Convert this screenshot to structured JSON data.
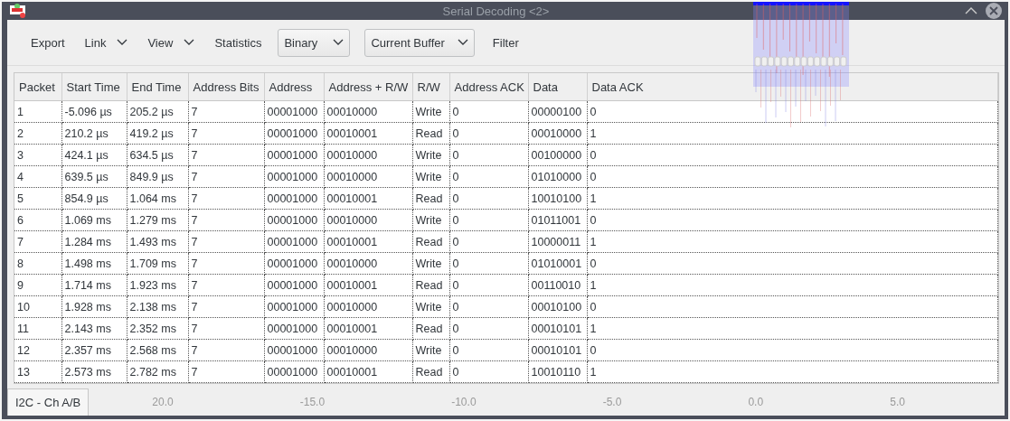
{
  "window": {
    "title": "Serial Decoding <2>"
  },
  "toolbar": [
    {
      "kind": "button",
      "label": "Export"
    },
    {
      "kind": "menu",
      "label": "Link"
    },
    {
      "kind": "menu",
      "label": "View"
    },
    {
      "kind": "button",
      "label": "Statistics"
    },
    {
      "kind": "select",
      "label": "Binary"
    },
    {
      "kind": "select",
      "label": "Current Buffer"
    },
    {
      "kind": "button",
      "label": "Filter"
    }
  ],
  "table": {
    "columns": [
      "Packet",
      "Start Time",
      "End Time",
      "Address Bits",
      "Address",
      "Address + R/W",
      "R/W",
      "Address ACK",
      "Data",
      "Data ACK"
    ],
    "rows": [
      [
        "1",
        "-5.096 µs",
        "205.2 µs",
        "7",
        "00001000",
        "00010000",
        "Write",
        "0",
        "00000100",
        "0"
      ],
      [
        "2",
        "210.2 µs",
        "419.2 µs",
        "7",
        "00001000",
        "00010001",
        "Read",
        "0",
        "00010000",
        "1"
      ],
      [
        "3",
        "424.1 µs",
        "634.5 µs",
        "7",
        "00001000",
        "00010000",
        "Write",
        "0",
        "00100000",
        "0"
      ],
      [
        "4",
        "639.5 µs",
        "849.9 µs",
        "7",
        "00001000",
        "00010000",
        "Write",
        "0",
        "01010000",
        "0"
      ],
      [
        "5",
        "854.9 µs",
        "1.064 ms",
        "7",
        "00001000",
        "00010001",
        "Read",
        "0",
        "10010100",
        "1"
      ],
      [
        "6",
        "1.069 ms",
        "1.279 ms",
        "7",
        "00001000",
        "00010000",
        "Write",
        "0",
        "01011001",
        "0"
      ],
      [
        "7",
        "1.284 ms",
        "1.493 ms",
        "7",
        "00001000",
        "00010001",
        "Read",
        "0",
        "10000011",
        "1"
      ],
      [
        "8",
        "1.498 ms",
        "1.709 ms",
        "7",
        "00001000",
        "00010000",
        "Write",
        "0",
        "01010001",
        "0"
      ],
      [
        "9",
        "1.714 ms",
        "1.923 ms",
        "7",
        "00001000",
        "00010001",
        "Read",
        "0",
        "00110010",
        "1"
      ],
      [
        "10",
        "1.928 ms",
        "2.138 ms",
        "7",
        "00001000",
        "00010000",
        "Write",
        "0",
        "00010100",
        "0"
      ],
      [
        "11",
        "2.143 ms",
        "2.352 ms",
        "7",
        "00001000",
        "00010001",
        "Read",
        "0",
        "00010101",
        "1"
      ],
      [
        "12",
        "2.357 ms",
        "2.568 ms",
        "7",
        "00001000",
        "00010000",
        "Write",
        "0",
        "00010101",
        "0"
      ],
      [
        "13",
        "2.573 ms",
        "2.782 ms",
        "7",
        "00001000",
        "00010001",
        "Read",
        "0",
        "10010110",
        "1"
      ]
    ]
  },
  "bottom_tabs": [
    {
      "label": "I2C - Ch A/B",
      "selected": true
    }
  ],
  "axis_labels": [
    "20.0",
    "-15.0",
    "-10.0",
    "-5.0",
    "0.0",
    "5.0"
  ]
}
